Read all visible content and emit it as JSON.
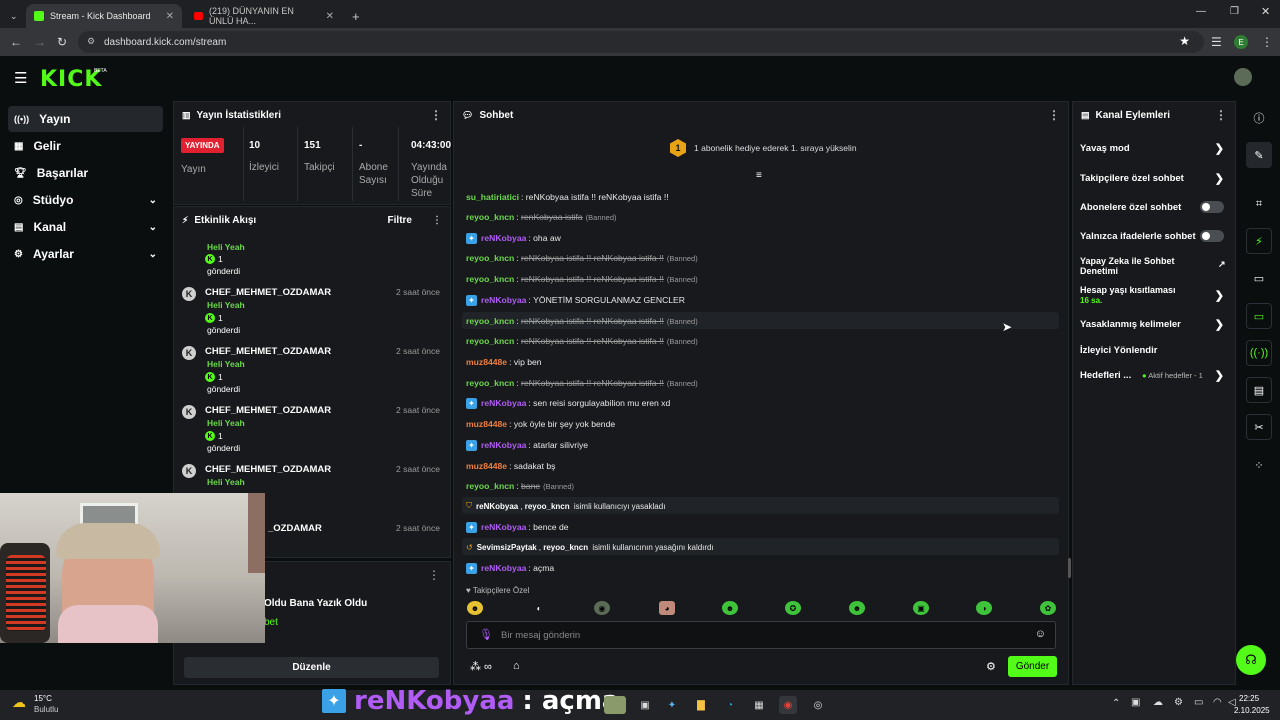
{
  "browser": {
    "tabs": [
      {
        "label": "Stream - Kick Dashboard",
        "active": true
      },
      {
        "label": "(219) DÜNYANIN EN ÜNLÜ HA...",
        "active": false
      }
    ],
    "url": "dashboard.kick.com/stream",
    "profile_initial": "E"
  },
  "header": {
    "logo": "KICK",
    "beta": "BETA"
  },
  "sidebar": {
    "items": [
      {
        "label": "Yayın",
        "icon": "broadcast-icon",
        "active": true
      },
      {
        "label": "Gelir",
        "icon": "revenue-icon"
      },
      {
        "label": "Başarılar",
        "icon": "trophy-icon"
      },
      {
        "label": "Stüdyo",
        "icon": "studio-icon",
        "chevron": true
      },
      {
        "label": "Kanal",
        "icon": "channel-icon",
        "chevron": true
      },
      {
        "label": "Ayarlar",
        "icon": "gear-icon",
        "chevron": true
      }
    ]
  },
  "stats": {
    "title": "Yayın İstatistikleri",
    "live_badge": "YAYINDA",
    "live_label": "Yayın",
    "viewers_value": "10",
    "viewers_label": "İzleyici",
    "followers_value": "151",
    "followers_label": "Takipçi",
    "subs_value": "-",
    "subs_label": "Abone Sayısı",
    "uptime_value": "04:43:00",
    "uptime_label": "Yayında Olduğu Süre"
  },
  "activity": {
    "title": "Etkinlik Akışı",
    "filter": "Filtre",
    "events": [
      {
        "name": "",
        "reward": "Heli Yeah",
        "count": "1",
        "sent": "gönderdi",
        "time": ""
      },
      {
        "name": "CHEF_MEHMET_OZDAMAR",
        "reward": "Heli Yeah",
        "count": "1",
        "sent": "gönderdi",
        "time": "2 saat önce"
      },
      {
        "name": "CHEF_MEHMET_OZDAMAR",
        "reward": "Heli Yeah",
        "count": "1",
        "sent": "gönderdi",
        "time": "2 saat önce"
      },
      {
        "name": "CHEF_MEHMET_OZDAMAR",
        "reward": "Heli Yeah",
        "count": "1",
        "sent": "gönderdi",
        "time": "2 saat önce"
      },
      {
        "name": "CHEF_MEHMET_OZDAMAR",
        "reward": "Heli Yeah",
        "count": "1",
        "sent": "gönderdi",
        "time": "2 saat önce"
      },
      {
        "name": "_OZDAMAR",
        "reward": "",
        "count": "",
        "sent": "",
        "time": "2 saat önce"
      }
    ]
  },
  "mini_panel": {
    "title_line": "Oldu Bana Yazık Oldu",
    "sub": "bet",
    "edit_button": "Düzenle"
  },
  "chat": {
    "title": "Sohbet",
    "banner_rank": "1",
    "banner_text": "1 abonelik hediye ederek 1. sıraya yükselin",
    "messages": [
      {
        "user": "su_hatiriatici",
        "color": "#6cd94a",
        "text": "reNKobyaa istifa !! reNKobyaa istifa !!",
        "deleted": false,
        "banned": ""
      },
      {
        "user": "reyoo_kncn",
        "color": "#6cd94a",
        "text": "renKobyaa istifa",
        "deleted": true,
        "banned": "(Banned)"
      },
      {
        "user": "reNKobyaa",
        "color": "#b05cf5",
        "text": "oha aw",
        "deleted": false,
        "banned": "",
        "badge": true
      },
      {
        "user": "reyoo_kncn",
        "color": "#6cd94a",
        "text": "reNKobyaa istifa !! reNKobyaa istifa !!",
        "deleted": true,
        "banned": "(Banned)"
      },
      {
        "user": "reyoo_kncn",
        "color": "#6cd94a",
        "text": "reNKobyaa istifa !! reNKobyaa istifa !!",
        "deleted": true,
        "banned": "(Banned)"
      },
      {
        "user": "reNKobyaa",
        "color": "#b05cf5",
        "text": "YÖNETİM SORGULANMAZ GENCLER",
        "deleted": false,
        "banned": "",
        "badge": true
      },
      {
        "user": "reyoo_kncn",
        "color": "#6cd94a",
        "text": "reNKobyaa istifa !! reNKobyaa istifa !!",
        "deleted": true,
        "banned": "(Banned)"
      },
      {
        "user": "reyoo_kncn",
        "color": "#6cd94a",
        "text": "reNKobyaa istifa !! reNKobyaa istifa !!",
        "deleted": true,
        "banned": "(Banned)"
      },
      {
        "user": "muz8448e",
        "color": "#f07f3c",
        "text": "vip ben",
        "deleted": false,
        "banned": ""
      },
      {
        "user": "reyoo_kncn",
        "color": "#6cd94a",
        "text": "reNKobyaa istifa !! reNKobyaa istifa !!",
        "deleted": true,
        "banned": "(Banned)"
      },
      {
        "user": "reNKobyaa",
        "color": "#b05cf5",
        "text": "sen reisi sorgulayabilion mu eren xd",
        "deleted": false,
        "banned": "",
        "badge": true
      },
      {
        "user": "muz8448e",
        "color": "#f07f3c",
        "text": "yok öyle bir şey yok bende",
        "deleted": false,
        "banned": ""
      },
      {
        "user": "reNKobyaa",
        "color": "#b05cf5",
        "text": "atarlar silivriye",
        "deleted": false,
        "banned": "",
        "badge": true
      },
      {
        "user": "muz8448e",
        "color": "#f07f3c",
        "text": "sadakat bş",
        "deleted": false,
        "banned": ""
      },
      {
        "user": "reyoo_kncn",
        "color": "#6cd94a",
        "text": "bane",
        "deleted": true,
        "banned": "(Banned)"
      }
    ],
    "mod_event_1": {
      "actor": "reNKobyaa",
      "target": "reyoo_kncn",
      "text": "isimli kullanıcıyı yasakladı"
    },
    "msg_bence": {
      "user": "reNKobyaa",
      "text": "bence de"
    },
    "mod_event_2": {
      "actor": "SevimsizPaytak",
      "target": "reyoo_kncn",
      "text": "isimli kullanıcının yasağını kaldırdı"
    },
    "msg_acma": {
      "user": "reNKobyaa",
      "text": "açma"
    },
    "followers_only": "Takipçilere Özel",
    "input_placeholder": "Bir mesaj gönderin",
    "send_button": "Gönder"
  },
  "actions": {
    "title": "Kanal Eylemleri",
    "items": [
      {
        "label": "Yavaş mod",
        "type": "arrow"
      },
      {
        "label": "Takipçilere özel sohbet",
        "type": "arrow"
      },
      {
        "label": "Abonelere özel sohbet",
        "type": "toggle"
      },
      {
        "label": "Yalnızca ifadelerle sohbet",
        "type": "toggle"
      },
      {
        "label": "Yapay Zeka ile Sohbet Denetimi",
        "type": "external"
      },
      {
        "label": "Hesap yaşı kısıtlaması",
        "sub": "16 sa.",
        "type": "arrow"
      },
      {
        "label": "Yasaklanmış kelimeler",
        "type": "arrow"
      },
      {
        "label": "İzleyici Yönlendir",
        "type": "none"
      },
      {
        "label": "Hedefleri ...",
        "sub": "Aktif hedefler - 1",
        "type": "arrow"
      }
    ]
  },
  "overlay": {
    "name": "reNKobyaa",
    "text": ": açma"
  },
  "taskbar": {
    "temp": "15°C",
    "weather": "Bulutlu",
    "time": "22:25",
    "date": "2.10.2025"
  }
}
